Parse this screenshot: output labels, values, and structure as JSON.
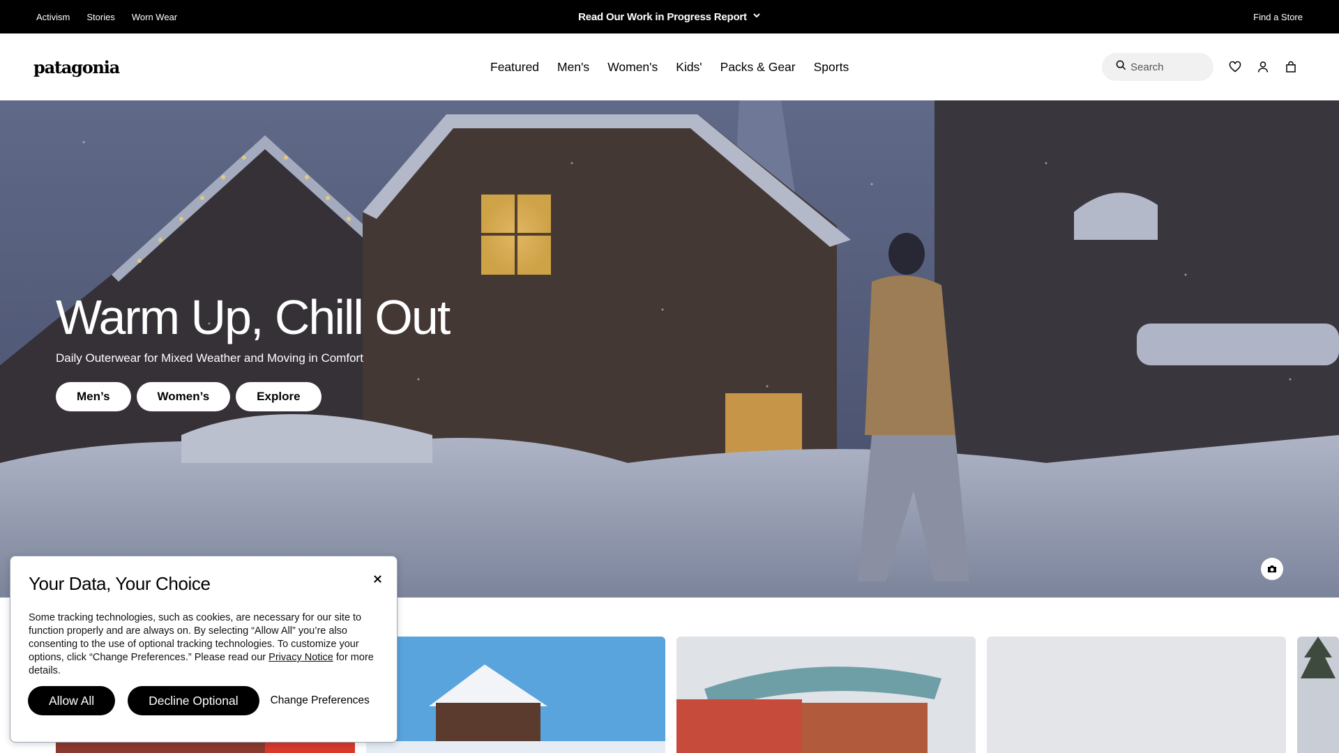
{
  "utility_bar": {
    "links": [
      "Activism",
      "Stories",
      "Worn Wear"
    ],
    "announcement": "Read Our Work in Progress Report",
    "find_store": "Find a Store"
  },
  "header": {
    "logo": "patagonia",
    "nav": [
      "Featured",
      "Men's",
      "Women's",
      "Kids'",
      "Packs & Gear",
      "Sports"
    ],
    "search_placeholder": "Search",
    "icons": [
      "search-icon",
      "heart-icon",
      "user-icon",
      "bag-icon"
    ]
  },
  "hero": {
    "title": "Warm Up, Chill Out",
    "subtitle": "Daily Outerwear for Mixed Weather and Moving in Comfort",
    "buttons": [
      "Men’s",
      "Women’s",
      "Explore"
    ],
    "photo_credit_icon": "camera-icon"
  },
  "cookie_modal": {
    "title": "Your Data, Your Choice",
    "body_before_link": "Some tracking technologies, such as cookies, are necessary for our site to function properly and are always on. By selecting “Allow All” you’re also consenting to the use of optional tracking technologies. To customize your options, click “Change Preferences.” Please read our ",
    "link_text": "Privacy Notice",
    "body_after_link": " for more details.",
    "allow_all": "Allow All",
    "decline_optional": "Decline Optional",
    "change_preferences": "Change Preferences",
    "close_icon": "close-icon"
  },
  "colors": {
    "utility_bar_bg": "#000000",
    "search_bg": "#f1f1f1",
    "button_dark": "#000000"
  }
}
